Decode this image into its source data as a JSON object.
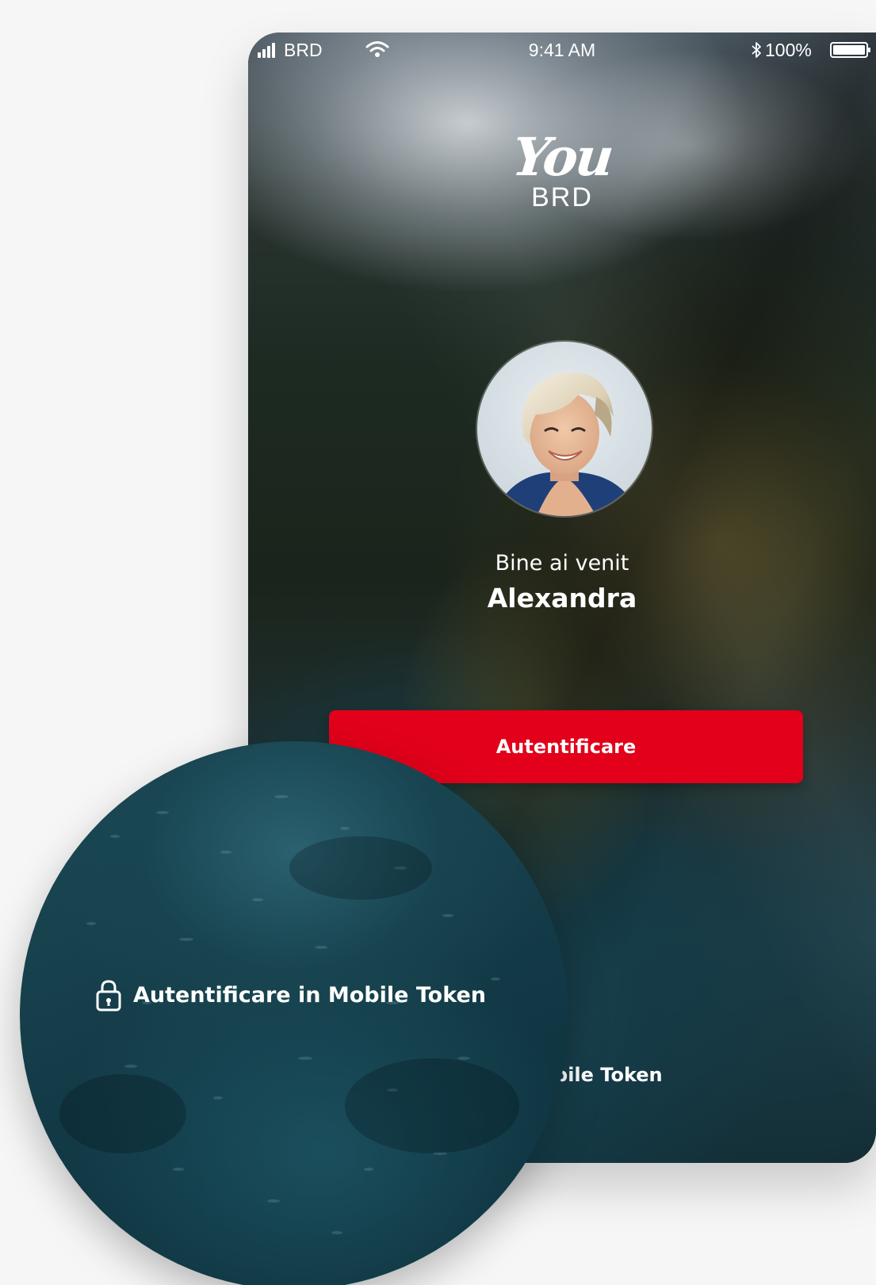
{
  "status_bar": {
    "carrier": "BRD",
    "time": "9:41 AM",
    "battery": "100%",
    "icons": [
      "signal-icon",
      "wifi-icon",
      "bluetooth-icon",
      "battery-icon"
    ]
  },
  "logo": {
    "primary": "You",
    "secondary": "BRD"
  },
  "greeting": {
    "line": "Bine ai venit",
    "name": "Alexandra"
  },
  "login": {
    "label": "Autentificare",
    "color": "#e2001a"
  },
  "token_link": {
    "visible_text": "e in Mobile Token",
    "icon": "lock-icon"
  },
  "zoom": {
    "label": "Autentificare in Mobile Token",
    "icon": "lock-icon"
  }
}
